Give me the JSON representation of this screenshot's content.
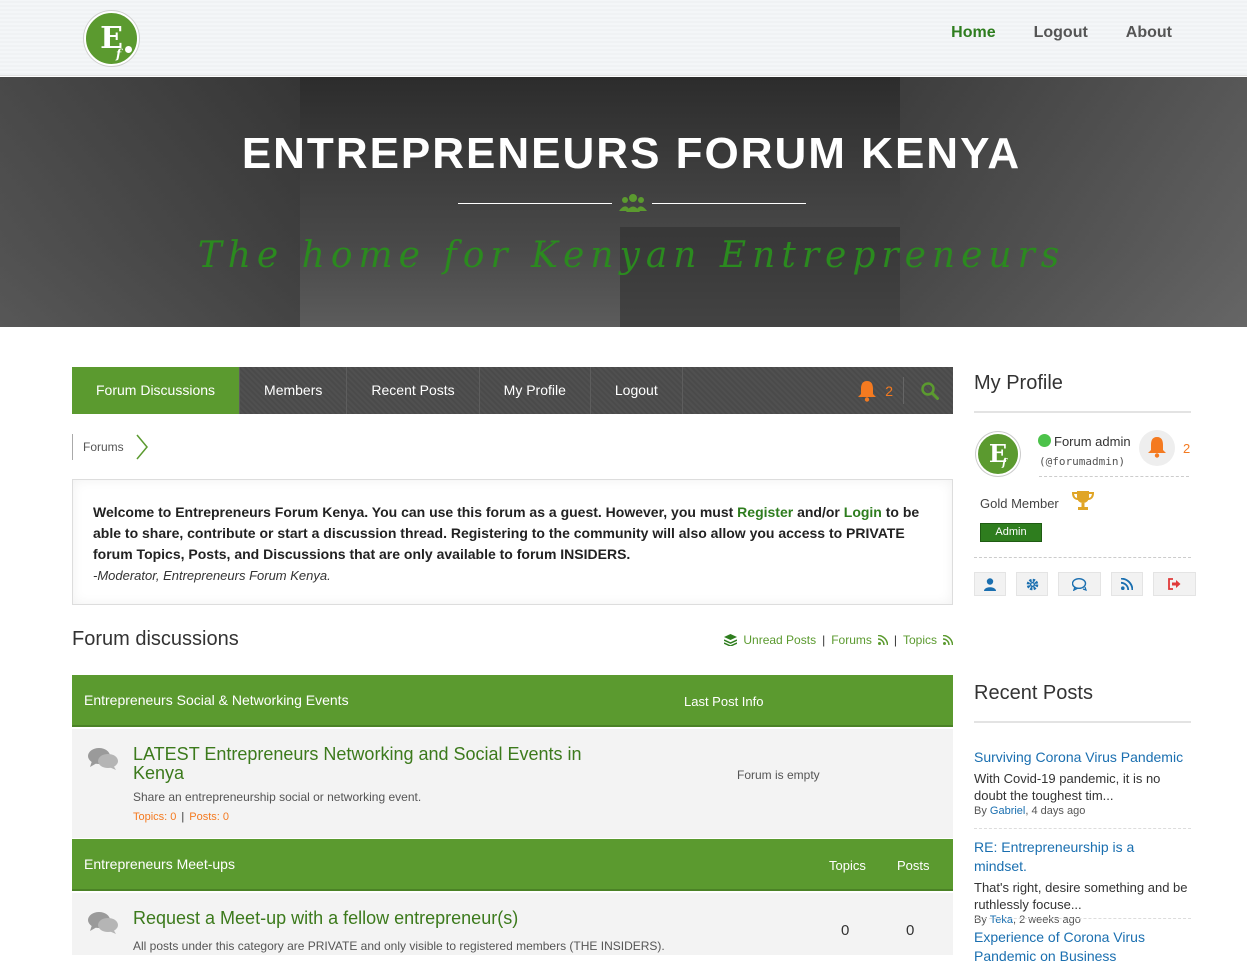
{
  "header": {
    "logo_text": "E",
    "logo_sub": "f",
    "nav": [
      {
        "label": "Home",
        "active": true
      },
      {
        "label": "Logout"
      },
      {
        "label": "About"
      }
    ]
  },
  "hero": {
    "title": "ENTREPRENEURS FORUM KENYA",
    "tagline": "The home for Kenyan Entrepreneurs",
    "divider_icon": "people-icon"
  },
  "main_nav": {
    "items": [
      "Forum Discussions",
      "Members",
      "Recent Posts",
      "My Profile",
      "Logout"
    ],
    "active_index": 0,
    "notification_count": "2",
    "bell_icon": "bell-icon",
    "search_icon": "search-icon"
  },
  "breadcrumb": {
    "items": [
      "Forums"
    ]
  },
  "welcome": {
    "text_1": "Welcome to Entrepreneurs Forum Kenya. You can use this forum as a guest. However, you must ",
    "register_link": "Register",
    "text_2": " and/or ",
    "login_link": "Login",
    "text_3": " to be able to share, contribute or start a discussion thread. Registering to the community will also allow you access to PRIVATE forum Topics, Posts, and Discussions that are only available to forum INSIDERS.",
    "signature": "-Moderator, Entrepreneurs Forum Kenya."
  },
  "forum": {
    "title": "Forum discussions",
    "links": {
      "unread": "Unread Posts",
      "forums": "Forums",
      "topics": "Topics",
      "separator": "|"
    },
    "categories": [
      {
        "name": "Entrepreneurs Social & Networking Events",
        "col_last_post": "Last Post Info",
        "forums": [
          {
            "title": "LATEST Entrepreneurs Networking and Social Events in Kenya",
            "description": "Share an entrepreneurship social or networking event.",
            "topics_label": "Topics: 0",
            "posts_label": "Posts: 0",
            "last_post": "Forum is empty"
          }
        ]
      },
      {
        "name": "Entrepreneurs Meet-ups",
        "col_topics": "Topics",
        "col_posts": "Posts",
        "forums": [
          {
            "title": "Request a Meet-up with a fellow entrepreneur(s)",
            "description": "All posts under this category are PRIVATE and only visible to registered members (THE INSIDERS).",
            "topics": "0",
            "posts": "0"
          }
        ]
      }
    ]
  },
  "sidebar": {
    "profile": {
      "heading": "My Profile",
      "name": "Forum admin",
      "handle": "(@forumadmin)",
      "notification_count": "2",
      "rank": "Gold Member",
      "badge": "Admin",
      "status_color": "#4cc24a"
    },
    "recent_posts": {
      "heading": "Recent Posts",
      "posts": [
        {
          "title": "Surviving Corona Virus Pandemic",
          "excerpt": "With Covid-19 pandemic, it is no doubt the toughest tim...",
          "by": "By ",
          "author": "Gabriel",
          "time": ", 4 days ago"
        },
        {
          "title": "RE: Entrepreneurship is a mindset.",
          "excerpt": "That's right, desire something and be ruthlessly focuse...",
          "by": "By ",
          "author": "Teka",
          "time": ", 2 weeks ago"
        },
        {
          "title": "Experience of Corona Virus Pandemic on Business"
        }
      ]
    }
  },
  "colors": {
    "brand_green": "#5b9a2f",
    "link_green": "#2e7d1e",
    "accent_orange": "#f47a20",
    "link_blue": "#1a6fb0"
  }
}
